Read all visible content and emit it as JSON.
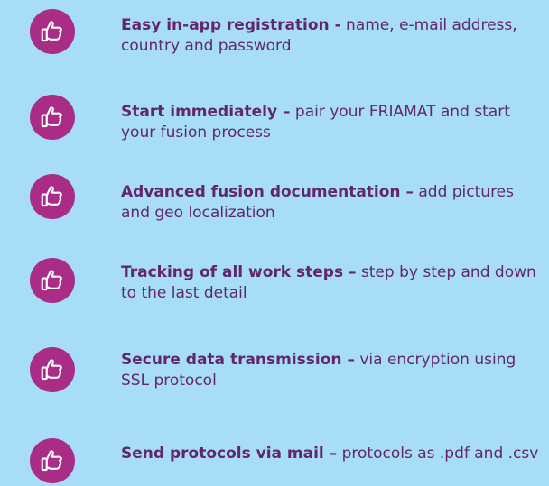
{
  "colors": {
    "background": "#a7ddf7",
    "icon_circle": "#a92c86",
    "text": "#62266f"
  },
  "features": [
    {
      "icon": "thumbs-up-icon",
      "title": "Easy in-app registration -",
      "description": "name, e-mail address, country and password"
    },
    {
      "icon": "thumbs-up-icon",
      "title": "Start immediately –",
      "description": "pair your FRIAMAT and start your fusion process"
    },
    {
      "icon": "thumbs-up-icon",
      "title": "Advanced fusion documentation –",
      "description": "add pictures and geo localization"
    },
    {
      "icon": "thumbs-up-icon",
      "title": "Tracking of all work steps –",
      "description": "step by step and down to the last detail"
    },
    {
      "icon": "thumbs-up-icon",
      "title": "Secure data transmission –",
      "description": "via encryption using SSL protocol"
    },
    {
      "icon": "thumbs-up-icon",
      "title": "Send protocols via mail –",
      "description": "protocols as .pdf and .csv"
    }
  ]
}
